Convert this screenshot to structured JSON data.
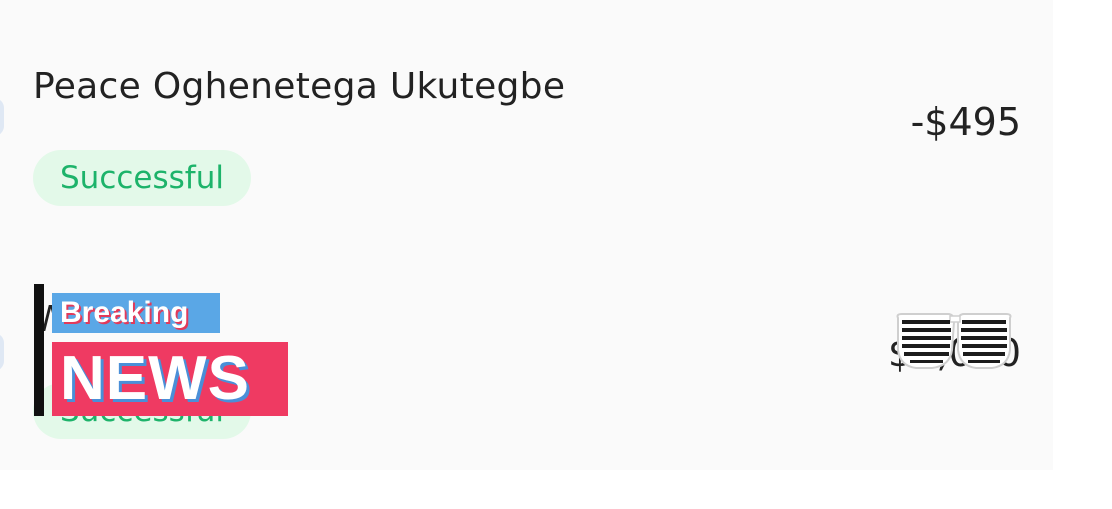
{
  "transactions": [
    {
      "name": "Peace Oghenetega Ukutegbe",
      "amount": "-$495",
      "status": "Successful"
    },
    {
      "name": "Wnc",
      "amount": "$5,000",
      "status": "Successful"
    }
  ],
  "stickers": {
    "breaking": "Breaking",
    "news": "NEWS",
    "glasses_icon": "shutter-shades-icon"
  },
  "colors": {
    "badge_bg": "#e3f9e9",
    "badge_text": "#1db36a",
    "news_red": "#ef3a62",
    "breaking_blue": "#5aa7e6"
  }
}
